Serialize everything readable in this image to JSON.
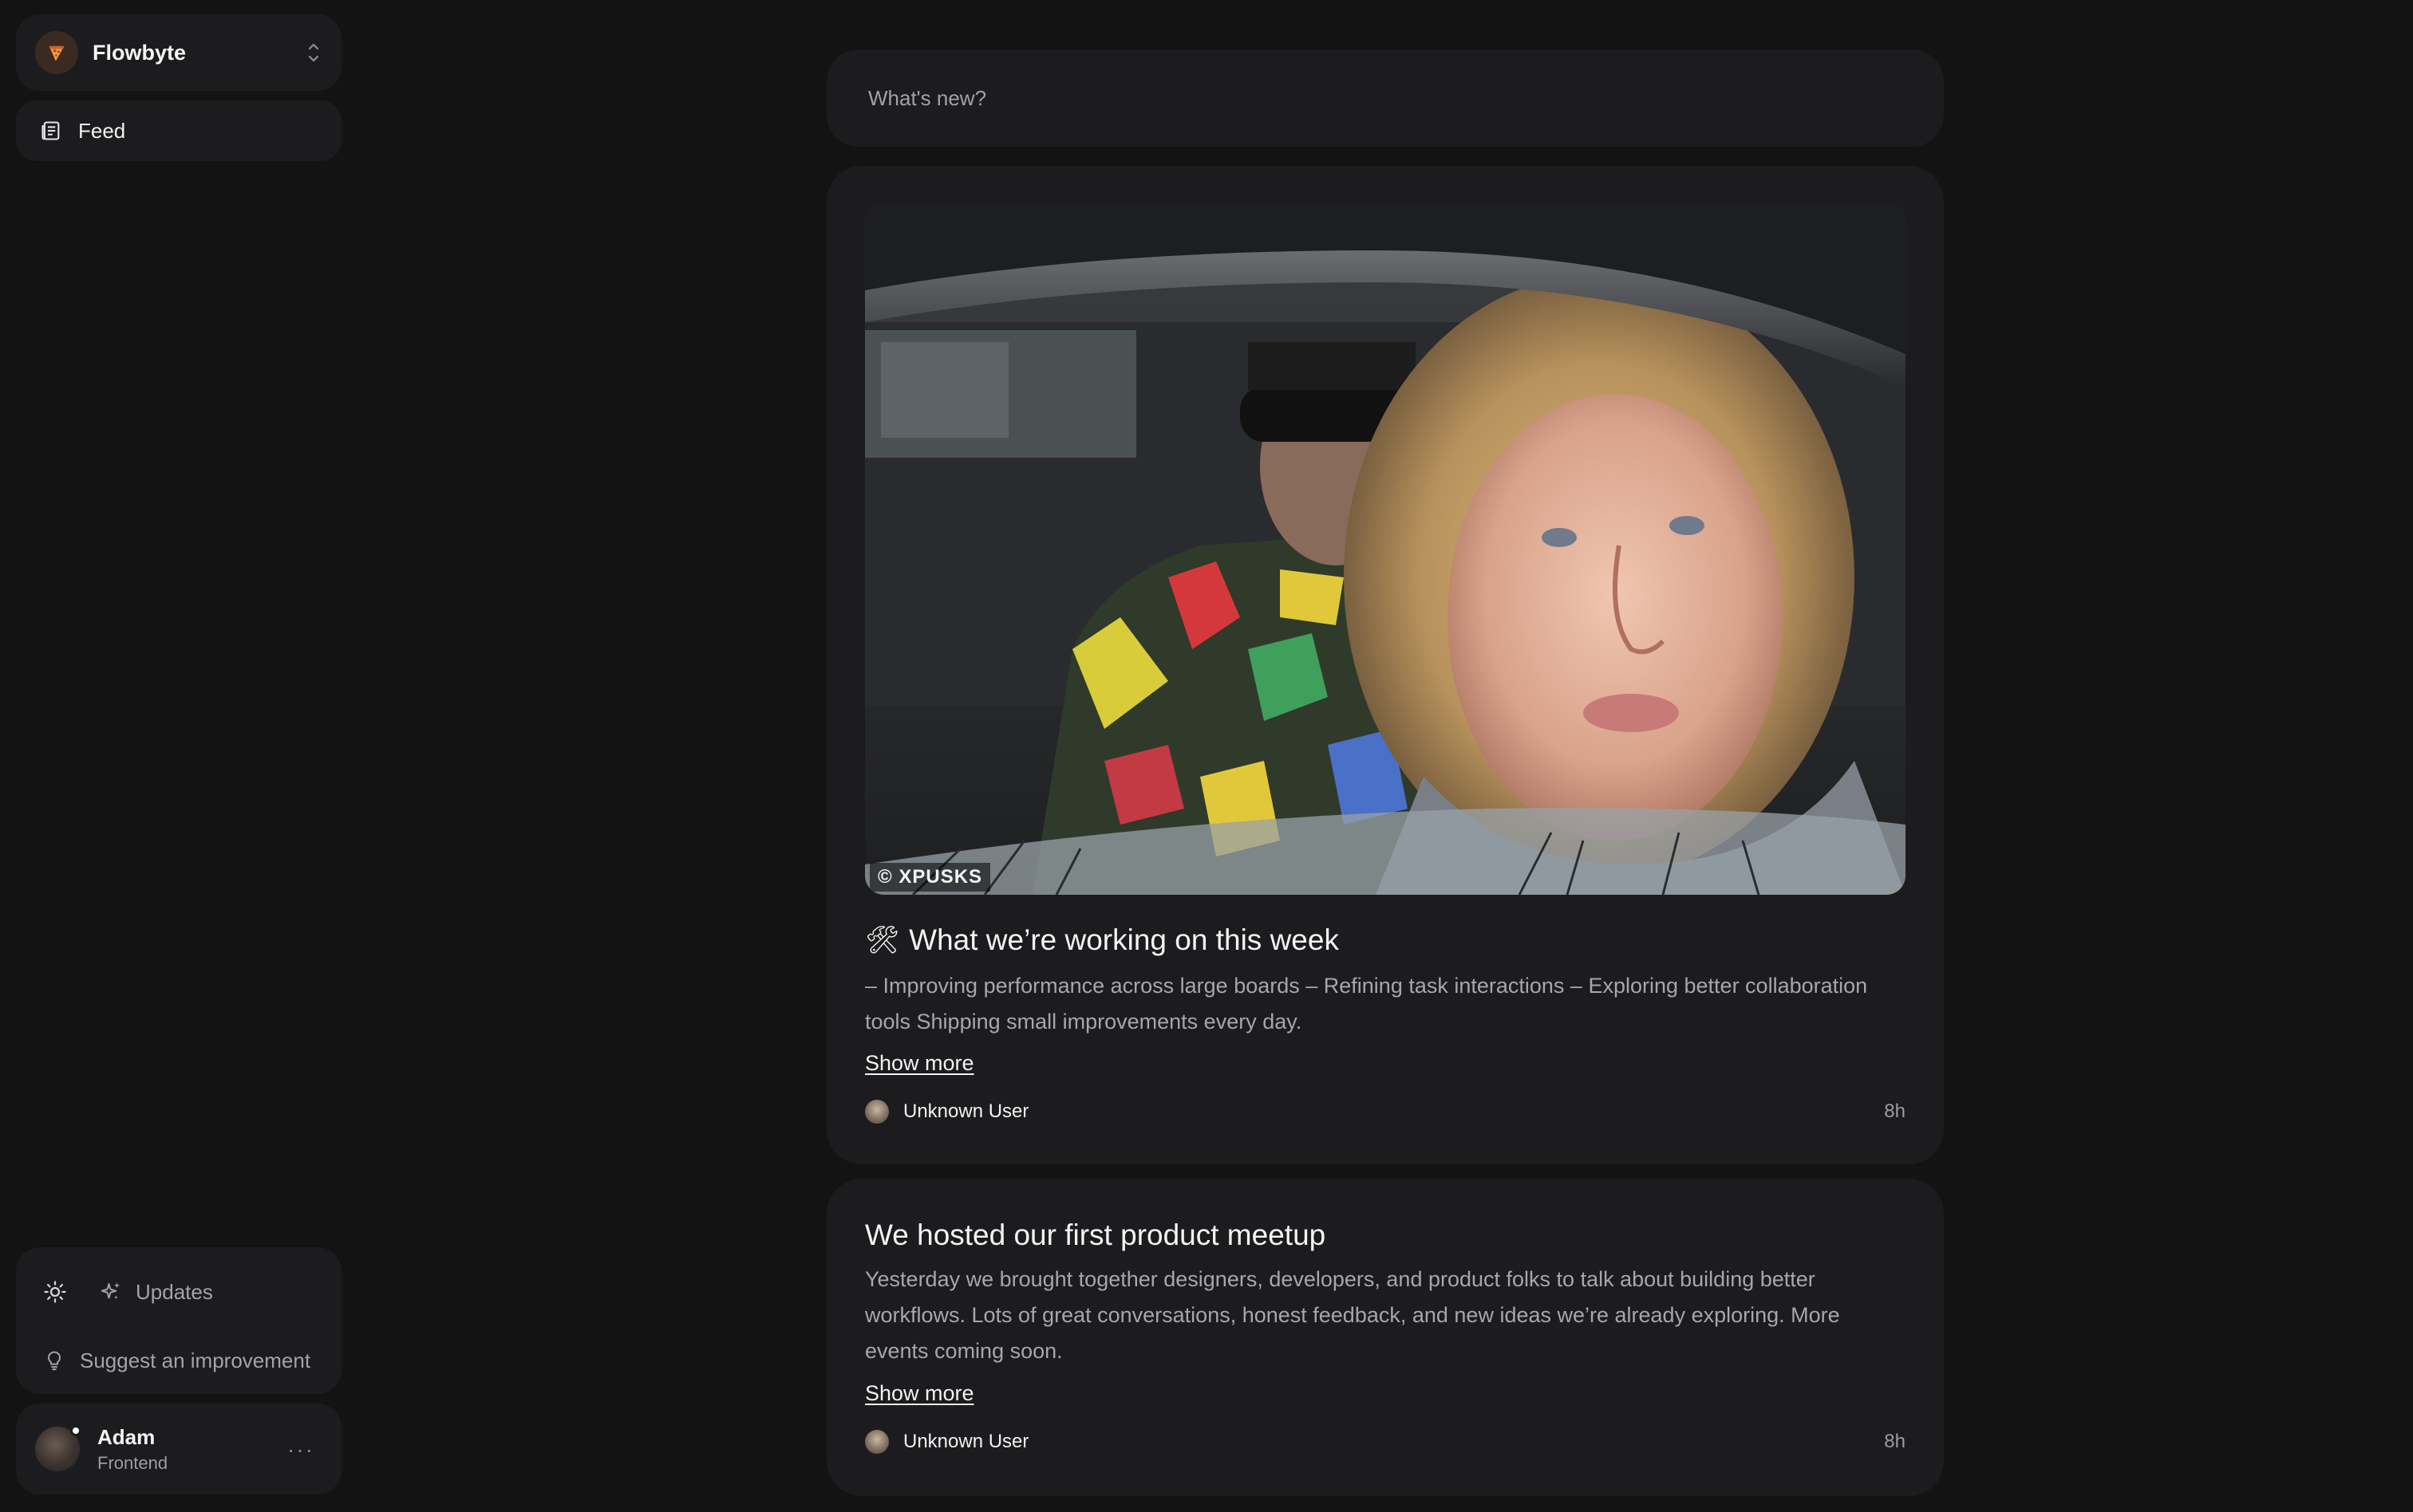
{
  "workspace": {
    "name": "Flowbyte",
    "logo_icon": "pizza-icon"
  },
  "sidebar": {
    "nav": [
      {
        "label": "Feed",
        "icon": "feed-icon"
      }
    ],
    "bottom": {
      "theme_icon": "sun-icon",
      "updates_label": "Updates",
      "suggest_label": "Suggest an improvement"
    },
    "user": {
      "name": "Adam",
      "role": "Frontend",
      "more": "···"
    }
  },
  "composer": {
    "placeholder": "What's new?"
  },
  "posts": [
    {
      "image_watermark": "© XPUSKS",
      "title_emoji": "🛠",
      "title": "What we’re working on this week",
      "body": "– Improving performance across large boards – Refining task interactions – Exploring better collaboration tools Shipping small improvements every day.",
      "show_more": "Show more",
      "author": "Unknown User",
      "time": "8h"
    },
    {
      "title": "We hosted our first product meetup",
      "body": "Yesterday we brought together designers, developers, and product folks to talk about building better workflows. Lots of great conversations, honest feedback, and new ideas we’re already exploring. More events coming soon.",
      "show_more": "Show more",
      "author": "Unknown User",
      "time": "8h"
    }
  ],
  "colors": {
    "background": "#131314",
    "surface": "#1c1c1e",
    "text": "#f2f2f3",
    "muted": "#a6a6ab"
  }
}
